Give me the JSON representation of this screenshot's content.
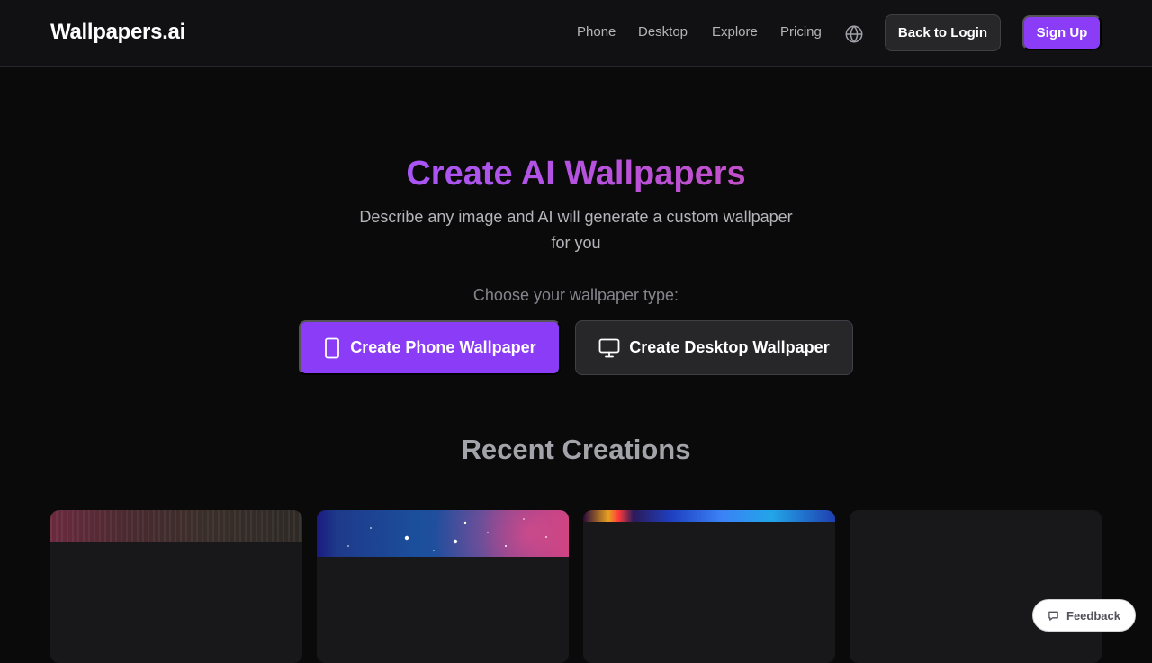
{
  "nav": {
    "logo": "Wallpapers.ai",
    "links": [
      {
        "label": "Phone"
      },
      {
        "label": "Desktop"
      },
      {
        "label": "Explore"
      },
      {
        "label": "Pricing"
      }
    ],
    "login_label": "Back to Login",
    "signup_label": "Sign Up",
    "language_icon": "globe-icon"
  },
  "hero": {
    "title": "Create AI Wallpapers",
    "subtitle": "Describe any image and AI will generate a custom wallpaper for you",
    "choose_label": "Choose your wallpaper type:",
    "phone_button": {
      "label": "Create Phone Wallpaper",
      "icon": "phone-icon"
    },
    "desktop_button": {
      "label": "Create Desktop Wallpaper",
      "icon": "monitor-icon"
    }
  },
  "recent": {
    "title": "Recent Creations",
    "cards": [
      {
        "name": "recent-creation-1"
      },
      {
        "name": "recent-creation-2"
      },
      {
        "name": "recent-creation-3"
      },
      {
        "name": "recent-creation-4"
      }
    ]
  },
  "feedback": {
    "label": "Feedback",
    "icon": "chat-icon"
  },
  "colors": {
    "accent": "#8b3cf7",
    "background": "#0a0a0b",
    "navbar": "#111113",
    "card": "#18181b",
    "title_gradient_start": "#a855f7",
    "title_gradient_end": "#c34fc9"
  }
}
